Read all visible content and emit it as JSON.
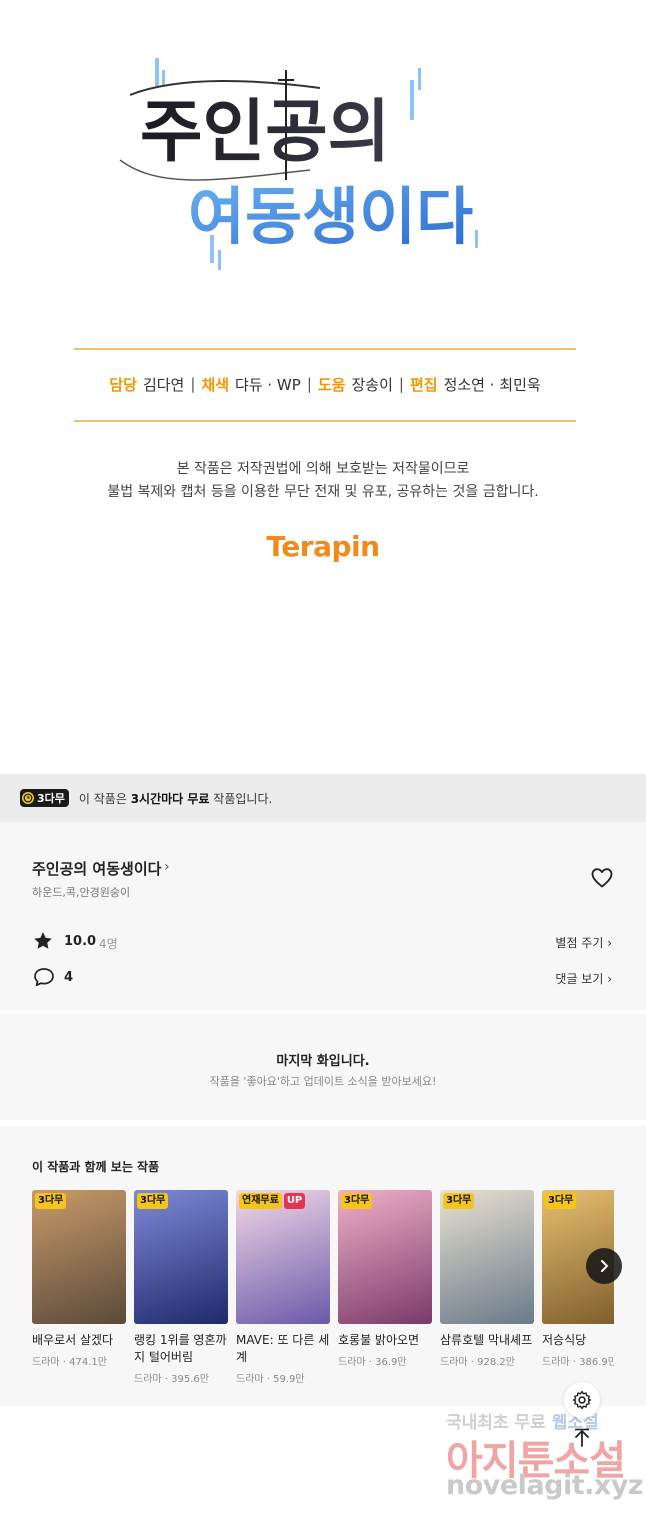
{
  "title_art": {
    "line1": "주인공의",
    "line2": "여동생이다"
  },
  "credits": [
    {
      "role": "담당",
      "names": "김다연"
    },
    {
      "role": "채색",
      "names": "댜듀 · WP"
    },
    {
      "role": "도움",
      "names": "장송이"
    },
    {
      "role": "편집",
      "names": "정소연 · 최민욱"
    }
  ],
  "credit_separator": "|",
  "notice": {
    "line1": "본 작품은 저작권법에 의해 보호받는 저작물이므로",
    "line2": "불법 복제와 캡처 등을 이용한 무단 전재 및 유포, 공유하는 것을 금합니다."
  },
  "publisher_logo": "Terapin",
  "free_banner": {
    "badge": "3다무",
    "text_prefix": "이 작품은 ",
    "text_bold": "3시간마다 무료",
    "text_suffix": " 작품입니다."
  },
  "work": {
    "title": "주인공의 여동생이다",
    "chevron": "›",
    "authors": "하운드,콕,안경원숭이",
    "rating": "10.0",
    "rating_count": "4명",
    "rate_link": "별점 주기 ›",
    "comment_count": "4",
    "comment_link": "댓글 보기 ›"
  },
  "last_episode": {
    "title": "마지막 화입니다.",
    "subtitle": "작품을 '좋아요'하고 업데이트 소식을 받아보세요!"
  },
  "recommendations": {
    "heading": "이 작품과 함께 보는 작품",
    "items": [
      {
        "title": "배우로서 살겠다",
        "meta": "드라마 · 474.1만",
        "badges": [
          "3다무"
        ],
        "colors": [
          "#5a4a3a",
          "#c89a6a"
        ]
      },
      {
        "title": "랭킹 1위를 영혼까지 털어버림",
        "meta": "드라마 · 395.6만",
        "badges": [
          "3다무"
        ],
        "colors": [
          "#1f2a6b",
          "#7e8ad8"
        ]
      },
      {
        "title": "MAVE: 또 다른 세계",
        "meta": "드라마 · 59.9만",
        "badges": [
          "연재무료",
          "UP"
        ],
        "colors": [
          "#6a5aa8",
          "#f2d8e8"
        ]
      },
      {
        "title": "호롱불 밝아오면",
        "meta": "드라마 · 36.9만",
        "badges": [
          "3다무"
        ],
        "colors": [
          "#7a3a6a",
          "#f0b0c8"
        ]
      },
      {
        "title": "삼류호텔 막내셰프",
        "meta": "드라마 · 928.2만",
        "badges": [
          "3다무"
        ],
        "colors": [
          "#6a7a8a",
          "#e8e0d0"
        ]
      },
      {
        "title": "저승식당",
        "meta": "드라마 · 386.9만",
        "badges": [
          "3다무"
        ],
        "colors": [
          "#7a5a2a",
          "#e8c070"
        ]
      }
    ]
  },
  "watermark": {
    "line1_prefix": "국내최초 무료 ",
    "line1_highlight": "웹소설",
    "line2": "아지툰소설",
    "line3": "novelagit.xyz"
  },
  "icons": {
    "heart": "heart-icon",
    "star": "star-icon",
    "comment": "comment-icon",
    "clock": "clock-icon",
    "next": "chevron-right-icon",
    "settings": "gear-icon",
    "top": "arrow-up-icon"
  },
  "colors": {
    "accent": "#f39800",
    "rule": "#f0c070",
    "badge_yellow": "#f5c518",
    "up_red": "#e8344e"
  }
}
